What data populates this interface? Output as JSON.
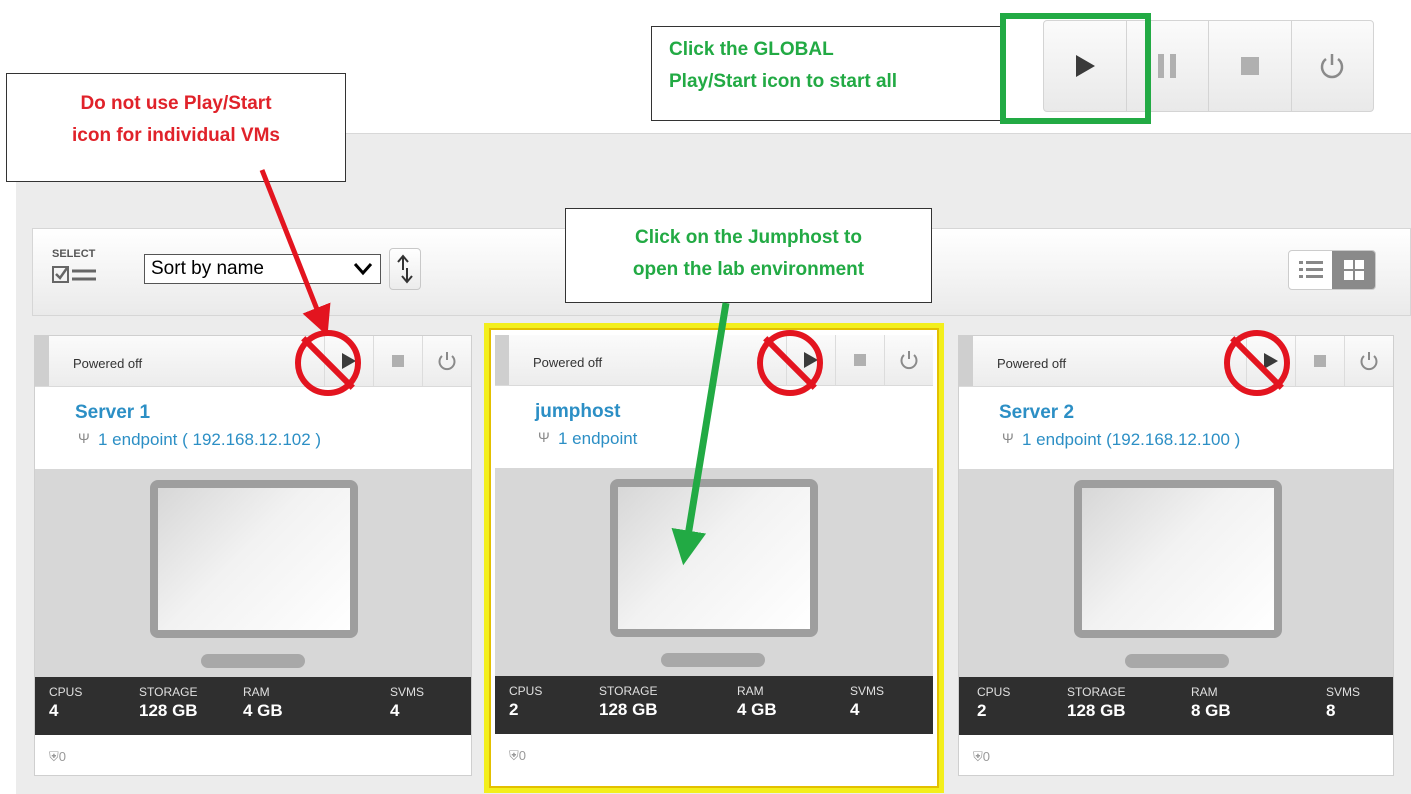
{
  "callouts": {
    "no_individual_line1": "Do not use Play/Start",
    "no_individual_line2": "icon for individual VMs",
    "global_line1": "Click the GLOBAL",
    "global_line2": "Play/Start icon to start all",
    "jumphost_line1": "Click on the Jumphost to",
    "jumphost_line2": "open the lab environment"
  },
  "toolbar": {
    "select_label": "SELECT",
    "sort_value": "Sort by name"
  },
  "vms": [
    {
      "state": "Powered off",
      "name": "Server 1",
      "endpoint": "1 endpoint ( 192.168.12.102 )",
      "cpus": "4",
      "storage": "128 GB",
      "ram": "4 GB",
      "svms": "4",
      "users": "0"
    },
    {
      "state": "Powered off",
      "name": "jumphost",
      "endpoint": "1 endpoint",
      "cpus": "2",
      "storage": "128 GB",
      "ram": "4 GB",
      "svms": "4",
      "users": "0"
    },
    {
      "state": "Powered off",
      "name": "Server 2",
      "endpoint": "1 endpoint (192.168.12.100 )",
      "cpus": "2",
      "storage": "128 GB",
      "ram": "8 GB",
      "svms": "8",
      "users": "0"
    }
  ],
  "spec_labels": {
    "cpus": "CPUS",
    "storage": "STORAGE",
    "ram": "RAM",
    "svms": "SVMS"
  },
  "colors": {
    "annotation_red": "#e3141f",
    "annotation_green": "#22aa44",
    "link_blue": "#2c8fc5",
    "highlight_yellow": "#f3ef1c",
    "spec_bar": "#2f2f2f"
  },
  "icons": [
    "play-icon",
    "pause-icon",
    "stop-icon",
    "power-icon",
    "select-checklist-icon",
    "sort-direction-icon",
    "list-view-icon",
    "grid-view-icon",
    "network-endpoint-icon",
    "users-icon",
    "no-entry-icon"
  ]
}
